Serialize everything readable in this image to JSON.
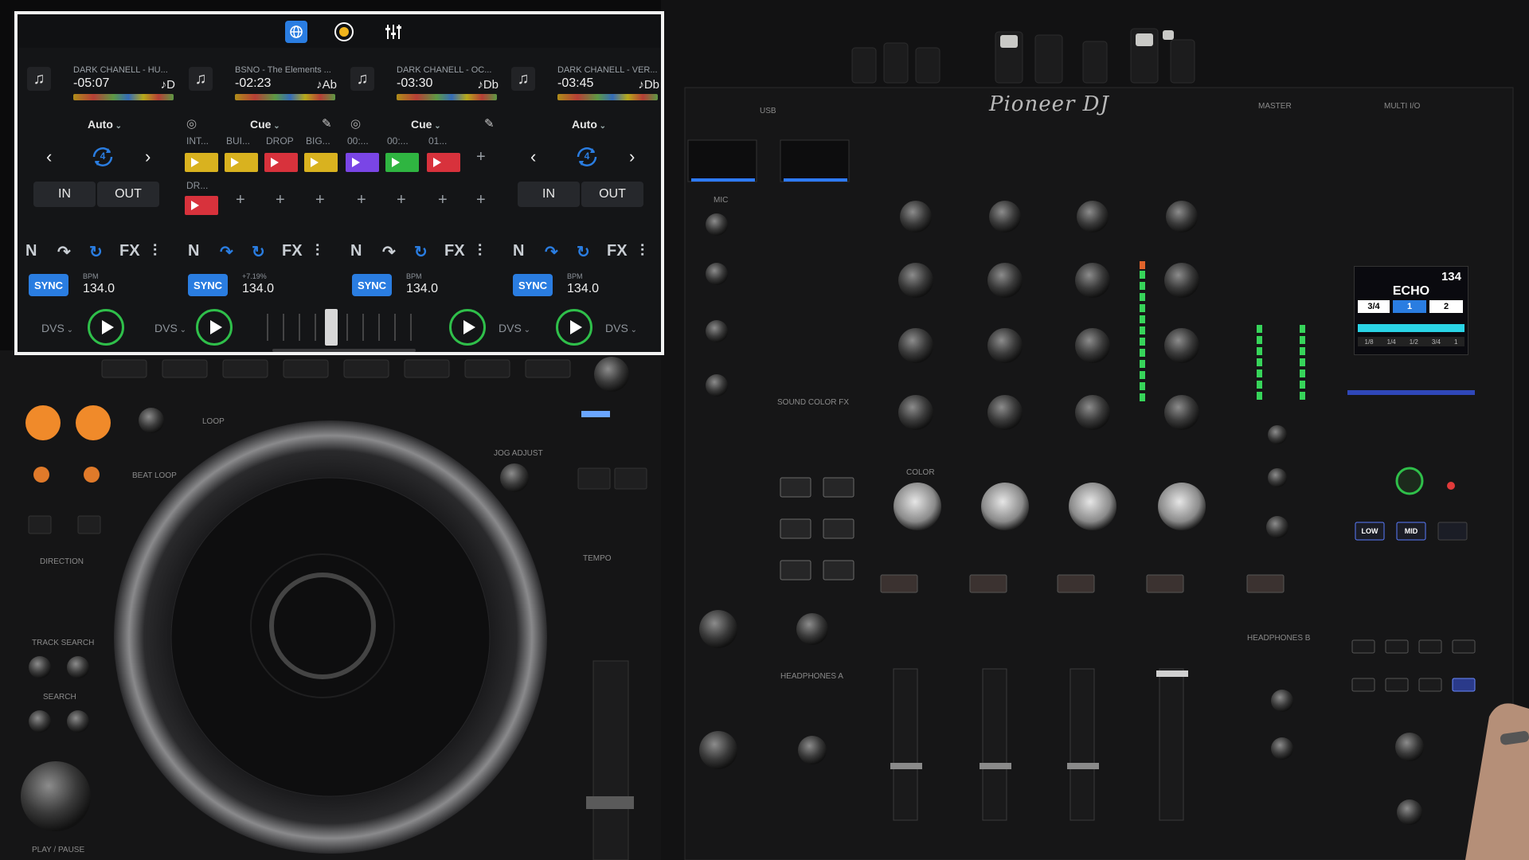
{
  "app": {
    "top_icons": [
      "globe-icon",
      "record-icon",
      "mixer-icon"
    ]
  },
  "decks": [
    {
      "title": "DARK CHANELL - HU...",
      "time": "-05:07",
      "key": "♪D",
      "mode": "Auto"
    },
    {
      "title": "BSNO - The Elements ...",
      "time": "-02:23",
      "key": "♪Ab",
      "mode": "Cue"
    },
    {
      "title": "DARK CHANELL - OC...",
      "time": "-03:30",
      "key": "♪Db",
      "mode": "Cue"
    },
    {
      "title": "DARK CHANELL - VER...",
      "time": "-03:45",
      "key": "♪Db",
      "mode": "Auto"
    }
  ],
  "loop": {
    "size_left": "4",
    "size_right": "4",
    "in": "IN",
    "out": "OUT"
  },
  "hotcues": {
    "labels": [
      "INT...",
      "BUI...",
      "DROP",
      "BIG...",
      "00:...",
      "00:...",
      "01..."
    ],
    "second_label": "DR...",
    "colors": [
      "#d9b21f",
      "#d9b21f",
      "#d8323c",
      "#d9b21f",
      "#7a45e6",
      "#2fb541",
      "#d8323c"
    ],
    "second_color": "#d8323c",
    "add_symbol": "+"
  },
  "tools": [
    "N",
    "↷",
    "↻",
    "FX",
    "⫶"
  ],
  "sync": [
    {
      "label": "SYNC",
      "bpm_label": "BPM",
      "bpm": "134.0"
    },
    {
      "label": "SYNC",
      "bpm_label": "+7.19%",
      "bpm": "134.0"
    },
    {
      "label": "SYNC",
      "bpm_label": "BPM",
      "bpm": "134.0"
    },
    {
      "label": "SYNC",
      "bpm_label": "BPM",
      "bpm": "134.0"
    }
  ],
  "transport": {
    "dvs_label": "DVS"
  },
  "hardware": {
    "brand": "Pioneer DJ",
    "labels": {
      "usb": "USB",
      "master": "MASTER",
      "multi_io": "MULTI I/O",
      "mic": "MIC",
      "sound_color_fx": "SOUND COLOR FX",
      "headphones_a": "HEADPHONES A",
      "headphones_b": "HEADPHONES B",
      "color": "COLOR",
      "beat_loop": "BEAT LOOP",
      "loop": "LOOP",
      "direction": "DIRECTION",
      "track_search": "TRACK SEARCH",
      "search": "SEARCH",
      "play_pause": "PLAY / PAUSE",
      "jog_adjust": "JOG ADJUST",
      "tempo": "TEMPO"
    },
    "fx_screen": {
      "bpm": "134",
      "effect": "ECHO",
      "cells": [
        "3/4",
        "1",
        "2"
      ],
      "beats": [
        "1/8",
        "1/4",
        "1/2",
        "3/4",
        "1"
      ]
    },
    "fx_buttons": {
      "low": "LOW",
      "mid": "MID"
    }
  },
  "colors": {
    "accent": "#2a7de1",
    "play": "#2fbf4a",
    "meter": "#37d45a",
    "fx_bar": "#2ad4e6"
  }
}
